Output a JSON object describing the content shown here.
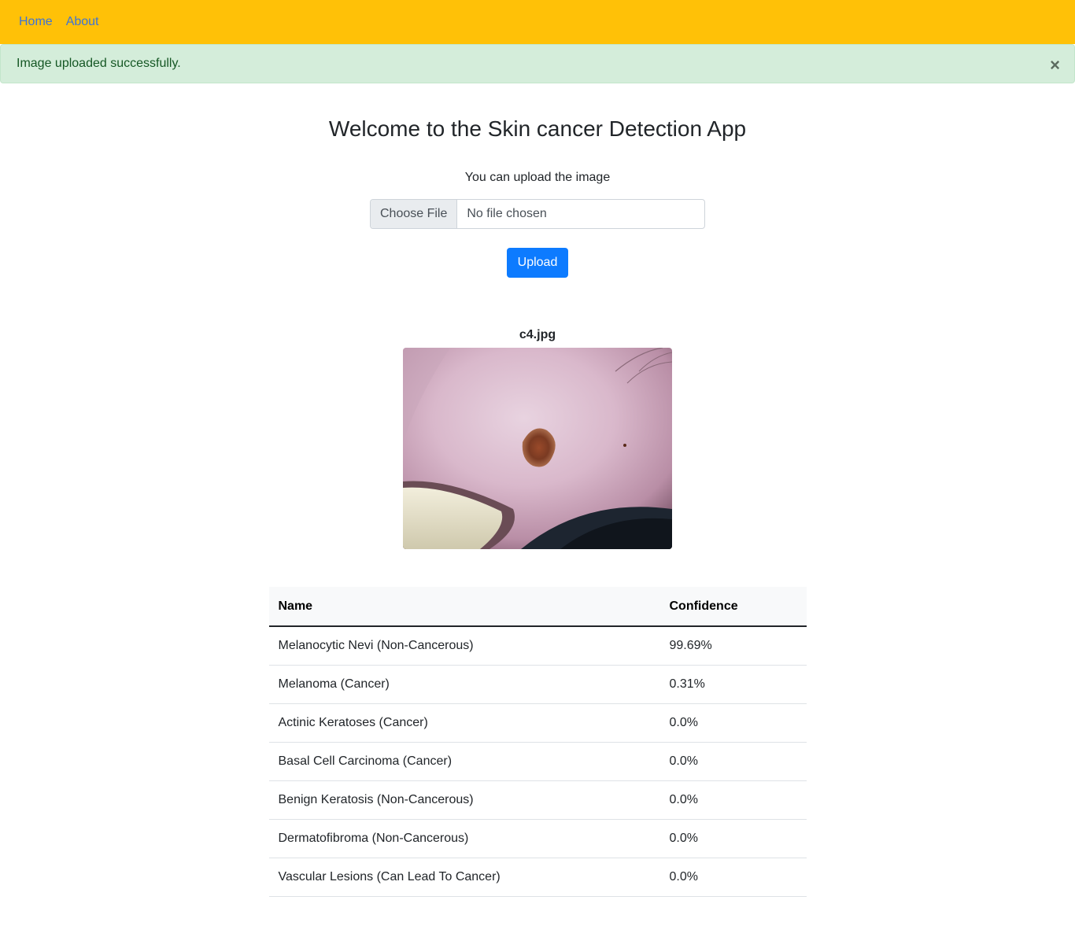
{
  "nav": {
    "items": [
      "Home",
      "About"
    ]
  },
  "alert": {
    "message": "Image uploaded successfully.",
    "close": "×"
  },
  "main": {
    "title": "Welcome to the Skin cancer Detection App",
    "prompt": "You can upload the image",
    "file_button": "Choose File",
    "file_status": "No file chosen",
    "upload_button": "Upload",
    "filename": "c4.jpg"
  },
  "table": {
    "headers": [
      "Name",
      "Confidence"
    ],
    "rows": [
      [
        "Melanocytic Nevi (Non-Cancerous)",
        "99.69%"
      ],
      [
        "Melanoma (Cancer)",
        "0.31%"
      ],
      [
        "Actinic Keratoses (Cancer)",
        "0.0%"
      ],
      [
        "Basal Cell Carcinoma (Cancer)",
        "0.0%"
      ],
      [
        "Benign Keratosis (Non-Cancerous)",
        "0.0%"
      ],
      [
        "Dermatofibroma (Non-Cancerous)",
        "0.0%"
      ],
      [
        "Vascular Lesions (Can Lead To Cancer)",
        "0.0%"
      ]
    ]
  },
  "colors": {
    "navbar": "#ffc107",
    "alert_bg": "#d4edda",
    "primary": "#0d7bff"
  }
}
